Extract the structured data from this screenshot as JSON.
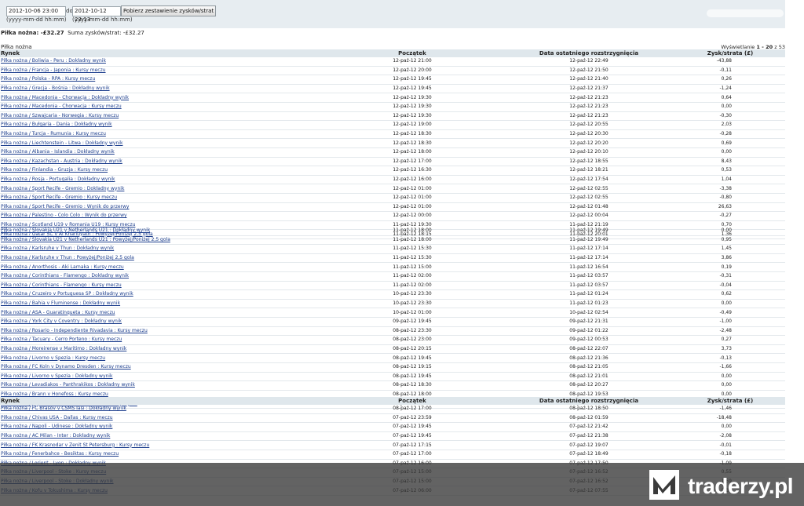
{
  "filter": {
    "from_value": "2012-10-06 23:00",
    "to_label": "do",
    "to_value": "2012-10-12 23:13",
    "format_hint_from": "(yyyy-mm-dd hh:mm)",
    "format_hint_to": "(yyyy-mm-dd hh:mm)",
    "submit_label": "Pobierz zestawienie zysków/strat"
  },
  "summary": {
    "title": "Piłka nożna: -£32.27",
    "total": "Suma zysków/strat: -£32.27"
  },
  "section_label": "Piłka nożna",
  "paging": {
    "prefix": "Wyświetlanie",
    "range": "1 - 20",
    "suffix": "z 53"
  },
  "table1": {
    "headers": [
      "Rynek",
      "Początek",
      "Data ostatniego rozstrzygnięcia",
      "Zysk/strata (£)"
    ],
    "rows": [
      [
        "Piłka nożna / Boliwia - Peru : Dokładny wynik",
        "12-paź-12 21:00",
        "12-paź-12 22:49",
        "-43,88"
      ],
      [
        "Piłka nożna / Francja - Japonia : Kursy meczu",
        "12-paź-12 20:00",
        "12-paź-12 21:50",
        "-0,11"
      ],
      [
        "Piłka nożna / Polska - RPA : Kursy meczu",
        "12-paź-12 19:45",
        "12-paź-12 21:40",
        "0,26"
      ],
      [
        "Piłka nożna / Grecja - Bośnia : Dokładny wynik",
        "12-paź-12 19:45",
        "12-paź-12 21:37",
        "-1,24"
      ],
      [
        "Piłka nożna / Macedonia - Chorwacja : Dokładny wynik",
        "12-paź-12 19:30",
        "12-paź-12 21:23",
        "0,64"
      ],
      [
        "Piłka nożna / Macedonia - Chorwacja : Kursy meczu",
        "12-paź-12 19:30",
        "12-paź-12 21:23",
        "0,00"
      ],
      [
        "Piłka nożna / Szwajcaria - Norwegia : Kursy meczu",
        "12-paź-12 19:30",
        "12-paź-12 21:23",
        "-0,30"
      ],
      [
        "Piłka nożna / Bułgaria - Dania : Dokładny wynik",
        "12-paź-12 19:00",
        "12-paź-12 20:55",
        "2,03"
      ],
      [
        "Piłka nożna / Turcja - Rumunia : Kursy meczu",
        "12-paź-12 18:30",
        "12-paź-12 20:30",
        "-0,28"
      ],
      [
        "Piłka nożna / Liechtenstein - Litwa : Dokładny wynik",
        "12-paź-12 18:30",
        "12-paź-12 20:20",
        "0,69"
      ],
      [
        "Piłka nożna / Albania - Islandia : Dokładny wynik",
        "12-paź-12 18:00",
        "12-paź-12 20:10",
        "0,00"
      ],
      [
        "Piłka nożna / Kazachstan - Austria : Dokładny wynik",
        "12-paź-12 17:00",
        "12-paź-12 18:55",
        "8,43"
      ],
      [
        "Piłka nożna / Finlandia - Gruzja : Kursy meczu",
        "12-paź-12 16:30",
        "12-paź-12 18:21",
        "0,53"
      ],
      [
        "Piłka nożna / Rosja - Portugalia : Dokładny wynik",
        "12-paź-12 16:00",
        "12-paź-12 17:54",
        "1,04"
      ],
      [
        "Piłka nożna / Sport Recife - Gremio : Dokładny wynik",
        "12-paź-12 01:00",
        "12-paź-12 02:55",
        "-3,38"
      ],
      [
        "Piłka nożna / Sport Recife - Gremio : Kursy meczu",
        "12-paź-12 01:00",
        "12-paź-12 02:55",
        "-0,80"
      ],
      [
        "Piłka nożna / Sport Recife - Gremio : Wynik do przerwy",
        "12-paź-12 01:00",
        "12-paź-12 01:48",
        "26,63"
      ],
      [
        "Piłka nożna / Palestino - Colo Colo : Wynik do przerwy",
        "12-paź-12 00:00",
        "12-paź-12 00:04",
        "-0,27"
      ],
      [
        "Piłka nożna / Scotland U19 v Romania U19 : Kursy meczu",
        "11-paź-12 19:30",
        "11-paź-12 21:19",
        "0,70"
      ],
      [
        "Piłka nożna / Qatar SC v Al Kharitiyath : Powyżej/Poniżej 2,5 gola",
        "11-paź-12 18:15",
        "11-paź-12 20:01",
        "1,36"
      ]
    ]
  },
  "table2": {
    "rows": [
      [
        "Piłka nożna / Slovakia U21 v Netherlands U21 : Dokładny wynik",
        "11-paź-12 18:00",
        "11-paź-12 19:49",
        "0,00"
      ],
      [
        "Piłka nożna / Slovakia U21 v Netherlands U21 : Powyżej/Poniżej 2,5 gola",
        "11-paź-12 18:00",
        "11-paź-12 19:49",
        "0,95"
      ],
      [
        "Piłka nożna / Karlsruhe v Thun : Dokładny wynik",
        "11-paź-12 15:30",
        "11-paź-12 17:14",
        "1,45"
      ],
      [
        "Piłka nożna / Karlsruhe v Thun : Powyżej/Poniżej 2,5 gola",
        "11-paź-12 15:30",
        "11-paź-12 17:14",
        "3,86"
      ],
      [
        "Piłka nożna / Anorthosis - Aki Larnaka : Kursy meczu",
        "11-paź-12 15:00",
        "11-paź-12 16:54",
        "0,19"
      ],
      [
        "Piłka nożna / Corinthians - Flamengo : Dokładny wynik",
        "11-paź-12 02:00",
        "11-paź-12 03:57",
        "-0,31"
      ],
      [
        "Piłka nożna / Corinthians - Flamengo : Kursy meczu",
        "11-paź-12 02:00",
        "11-paź-12 03:57",
        "-0,04"
      ],
      [
        "Piłka nożna / Cruzeiro v Portuguesa SP : Dokładny wynik",
        "10-paź-12 23:30",
        "11-paź-12 01:24",
        "0,62"
      ],
      [
        "Piłka nożna / Bahia v Fluminense : Dokładny wynik",
        "10-paź-12 23:30",
        "11-paź-12 01:23",
        "0,00"
      ],
      [
        "Piłka nożna / ASA - Guaratinqueta : Kursy meczu",
        "10-paź-12 01:00",
        "10-paź-12 02:54",
        "-0,49"
      ],
      [
        "Piłka nożna / York City v Coventry : Dokładny wynik",
        "09-paź-12 19:45",
        "09-paź-12 21:31",
        "-1,00"
      ],
      [
        "Piłka nożna / Rosario - Independiente Rivadavia : Kursy meczu",
        "08-paź-12 23:30",
        "09-paź-12 01:22",
        "-2,48"
      ],
      [
        "Piłka nożna / Tacuary - Cerro Porteno : Kursy meczu",
        "08-paź-12 23:00",
        "09-paź-12 00:53",
        "0,27"
      ],
      [
        "Piłka nożna / Moreirense v Maritimo : Dokładny wynik",
        "08-paź-12 20:15",
        "08-paź-12 22:07",
        "3,73"
      ],
      [
        "Piłka nożna / Livorno v Spezia : Kursy meczu",
        "08-paź-12 19:45",
        "08-paź-12 21:36",
        "-0,13"
      ],
      [
        "Piłka nożna / FC Koln v Dynamo Dresden : Kursy meczu",
        "08-paź-12 19:15",
        "08-paź-12 21:05",
        "-1,66"
      ],
      [
        "Piłka nożna / Livorno v Spezia : Dokładny wynik",
        "08-paź-12 19:45",
        "08-paź-12 21:01",
        "0,00"
      ],
      [
        "Piłka nożna / Levadiakos - Panthrakikos : Dokładny wynik",
        "08-paź-12 18:30",
        "08-paź-12 20:27",
        "0,00"
      ],
      [
        "Piłka nożna / Brann v Honefoss : Kursy meczu",
        "08-paź-12 18:00",
        "08-paź-12 19:53",
        "0,00"
      ],
      [
        "Piłka nożna / Jagiellonia - Lechia Gdańsk : Dokładny wynik",
        "08-paź-12 17:30",
        "08-paź-12 19:24",
        "0,68"
      ]
    ]
  },
  "table3": {
    "headers": [
      "Rynek",
      "Początek",
      "Data ostatniego rozstrzygnięcia",
      "Zysk/strata (£)"
    ],
    "rows": [
      [
        "Piłka nożna / FC Brasov v CSMS Iasi : Dokładny wynik",
        "08-paź-12 17:00",
        "08-paź-12 18:50",
        "-1,46"
      ],
      [
        "Piłka nożna / Chivas USA - Dallas : Kursy meczu",
        "07-paź-12 23:59",
        "08-paź-12 01:59",
        "-18,48"
      ],
      [
        "Piłka nożna / Napoli - Udinese : Dokładny wynik",
        "07-paź-12 19:45",
        "07-paź-12 21:42",
        "0,00"
      ],
      [
        "Piłka nożna / AC Milan - Inter : Dokładny wynik",
        "07-paź-12 19:45",
        "07-paź-12 21:38",
        "-2,08"
      ],
      [
        "Piłka nożna / FK Krasnodar v Zenit St Petersburg : Kursy meczu",
        "07-paź-12 17:15",
        "07-paź-12 19:07",
        "-0,01"
      ],
      [
        "Piłka nożna / Fenerbahce - Besiktas : Kursy meczu",
        "07-paź-12 17:00",
        "07-paź-12 18:49",
        "-0,18"
      ],
      [
        "Piłka nożna / Lorient - Lyon : Dokładny wynik",
        "07-paź-12 16:00",
        "07-paź-12 17:50",
        "-1,09"
      ],
      [
        "Piłka nożna / Liverpool - Stoke : Kursy meczu",
        "07-paź-12 15:00",
        "07-paź-12 16:52",
        "0,55"
      ],
      [
        "Piłka nożna / Liverpool - Stoke : Dokładny wynik",
        "07-paź-12 15:00",
        "07-paź-12 16:52",
        "-1,59"
      ],
      [
        "Piłka nożna / Kofu v Tokushima : Kursy meczu",
        "07-paź-12 06:00",
        "07-paź-12 07:55",
        "0,33"
      ]
    ]
  },
  "watermark": {
    "brand": "traderzy.pl"
  }
}
